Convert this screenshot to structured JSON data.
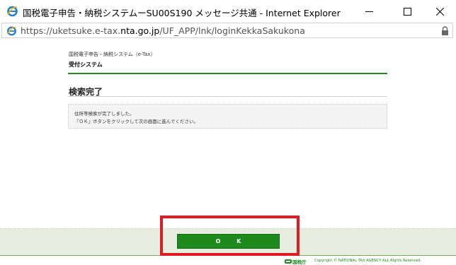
{
  "window": {
    "title": "国税電子申告・納税システムーSU00S190 メッセージ共通 - Internet Explorer",
    "minimize_icon": "minimize-icon",
    "maximize_icon": "maximize-icon",
    "close_icon": "close-icon"
  },
  "address": {
    "prefix": "https://uketsuke.e-tax.",
    "host": "nta.go.jp",
    "path": "/UF_APP/lnk/loginKekkaSakukona"
  },
  "page": {
    "breadcrumb": "国税電子申告・納税システム（e-Tax）",
    "system_name": "受付システム",
    "title": "検索完了",
    "message_line1": "住所等検索が完了しました。",
    "message_line2": "『ＯＫ』ボタンをクリックして次の画面に進んでください。",
    "ok_label": "O K"
  },
  "footer": {
    "logo_text": "国税庁",
    "copyright": "Copyright © NATIONAL TAX AGENCY ALL Rights Reserved."
  },
  "colors": {
    "brand_green": "#1e8a1e",
    "highlight_red": "#e01b22",
    "footer_band": "#e7eedf"
  }
}
